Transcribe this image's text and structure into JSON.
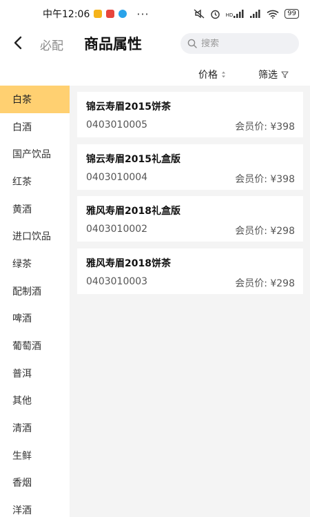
{
  "status": {
    "time": "中午12:06",
    "more": "···",
    "battery": "99",
    "signal_label": "HD"
  },
  "header": {
    "brand": "必配",
    "title": "商品属性",
    "search_placeholder": "搜索"
  },
  "sortbar": {
    "price_label": "价格",
    "filter_label": "筛选"
  },
  "sidebar": {
    "items": [
      {
        "label": "白茶"
      },
      {
        "label": "白酒"
      },
      {
        "label": "国产饮品"
      },
      {
        "label": "红茶"
      },
      {
        "label": "黄酒"
      },
      {
        "label": "进口饮品"
      },
      {
        "label": "绿茶"
      },
      {
        "label": "配制酒"
      },
      {
        "label": "啤酒"
      },
      {
        "label": "葡萄酒"
      },
      {
        "label": "普洱"
      },
      {
        "label": "其他"
      },
      {
        "label": "清酒"
      },
      {
        "label": "生鲜"
      },
      {
        "label": "香烟"
      },
      {
        "label": "洋酒"
      }
    ],
    "active_index": 0
  },
  "products": [
    {
      "name": "锦云寿眉2015饼茶",
      "code": "0403010005",
      "price": "会员价: ¥398"
    },
    {
      "name": "锦云寿眉2015礼盒版",
      "code": "0403010004",
      "price": "会员价: ¥398"
    },
    {
      "name": "雅风寿眉2018礼盒版",
      "code": "0403010002",
      "price": "会员价: ¥298"
    },
    {
      "name": "雅风寿眉2018饼茶",
      "code": "0403010003",
      "price": "会员价: ¥298"
    }
  ],
  "colors": {
    "active_category": "#ffd071",
    "content_bg": "#f4f4f4",
    "search_bg": "#f0f1f4"
  }
}
